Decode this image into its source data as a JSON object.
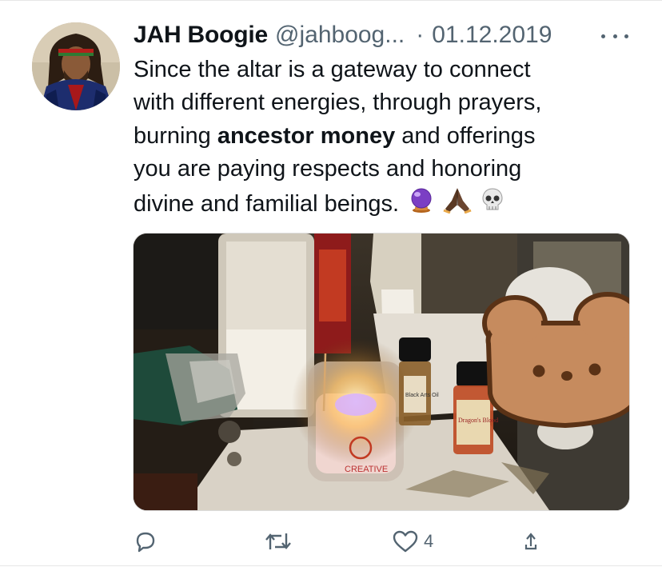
{
  "tweet": {
    "author": {
      "display_name": "JAH Boogie",
      "handle": "@jahboog..."
    },
    "separator": "·",
    "date": "01.12.2019",
    "text": {
      "line1": "Since the altar is a gateway to connect",
      "line2": "with different energies, through prayers,",
      "line3_pre": "burning ",
      "line3_bold": "ancestor money",
      "line3_post": " and offerings",
      "line4": "you are paying respects and honoring",
      "line5": "divine and familial beings.",
      "emojis": [
        "crystal-ball",
        "folded-hands",
        "skull"
      ]
    },
    "media": {
      "label_bottle_left": "Black Arts Oil",
      "label_bottle_right": "Dragon's Blood",
      "candle_label": "CREATIVE"
    },
    "actions": {
      "reply": "",
      "retweet": "",
      "like_count": "4",
      "share": ""
    }
  },
  "colors": {
    "text": "#0f1419",
    "secondary": "#536471",
    "background": "#ffffff",
    "bear_sticker": "#c68b5e",
    "bear_outline": "#5a3216"
  }
}
